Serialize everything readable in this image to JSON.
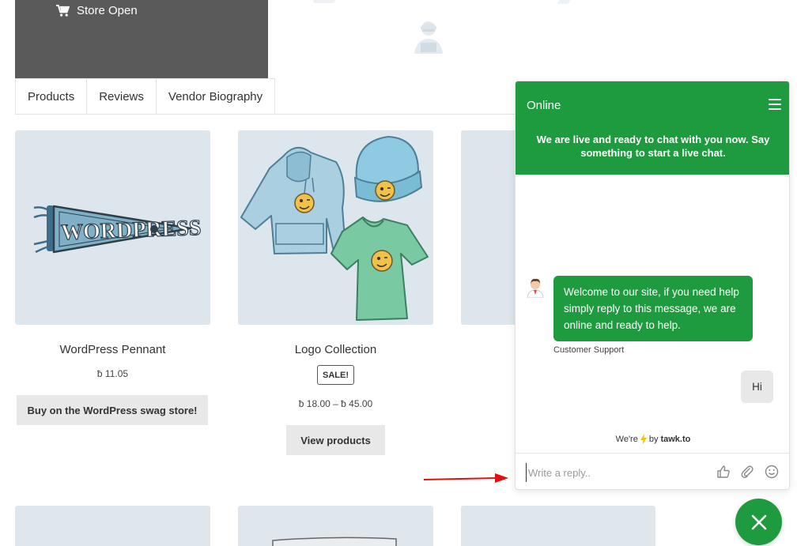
{
  "store": {
    "status": "Store Open"
  },
  "tabs": [
    {
      "label": "Products"
    },
    {
      "label": "Reviews"
    },
    {
      "label": "Vendor Biography"
    }
  ],
  "products": [
    {
      "name": "WordPress Pennant",
      "price": "ƀ 11.05",
      "button": "Buy on the WordPress swag store!",
      "image_text": "WORDPRESS"
    },
    {
      "name": "Logo Collection",
      "badge": "SALE!",
      "price": "ƀ 18.00 – ƀ 45.00",
      "button": "View products"
    }
  ],
  "chat": {
    "status": "Online",
    "subtitle": "We are live and ready to chat with you now. Say something to start a live chat.",
    "agent_message": "Welcome to our site, if you need help simply reply to this message, we are online and ready to help.",
    "agent_name": "Customer Support",
    "user_message": "Hi",
    "powered_prefix": "We're",
    "powered_by": "by",
    "powered_brand": "tawk.to",
    "reply_placeholder": "Write a reply.."
  },
  "colors": {
    "brand_green": "#1f9b3f",
    "banner": "#5a5a5a",
    "product_bg": "#dde6ec",
    "arrow": "#e01010"
  },
  "icons": [
    "cart-icon",
    "vendor-avatar-icon",
    "menu-icon",
    "agent-avatar-icon",
    "lightning-icon",
    "thumbs-up-icon",
    "attach-icon",
    "emoji-icon",
    "close-icon",
    "arrow-icon"
  ]
}
